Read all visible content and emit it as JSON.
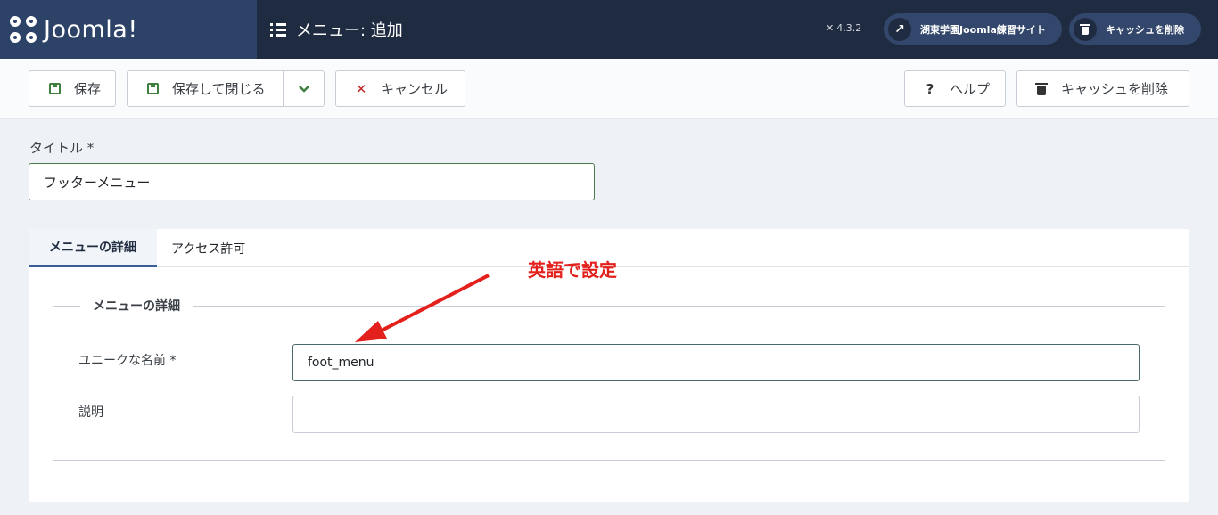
{
  "header": {
    "brand": "Joomla!",
    "page_title": "メニュー: 追加",
    "version": "4.3.2",
    "site_button": "湖東学園Joomla練習サイト",
    "clear_cache_button": "キャッシュを削除"
  },
  "toolbar": {
    "save": "保存",
    "save_close": "保存して閉じる",
    "cancel": "キャンセル",
    "help": "ヘルプ",
    "clear_cache": "キャッシュを削除"
  },
  "form": {
    "title_label": "タイトル *",
    "title_value": "フッターメニュー",
    "tabs": [
      "メニューの詳細",
      "アクセス許可"
    ],
    "fieldset_legend": "メニューの詳細",
    "unique_name_label": "ユニークな名前 *",
    "unique_name_value": "foot_menu",
    "description_label": "説明",
    "description_value": ""
  },
  "annotation": {
    "text": "英語で設定",
    "color": "#e3201b"
  },
  "colors": {
    "header_bg": "#1f2b40",
    "brand_bg": "#2c4267",
    "save_icon": "#3e7f3e",
    "cancel_icon": "#c52827",
    "active_tab_border": "#3a5d96"
  },
  "icons": {
    "brand": "joomla-logo-icon",
    "page_title": "list-icon",
    "version": "joomla-small-icon",
    "site": "external-link-icon",
    "clear_cache": "trash-icon",
    "save": "floppy-disk-icon",
    "dropdown": "chevron-down-icon",
    "cancel": "x-icon",
    "help": "question-icon"
  }
}
